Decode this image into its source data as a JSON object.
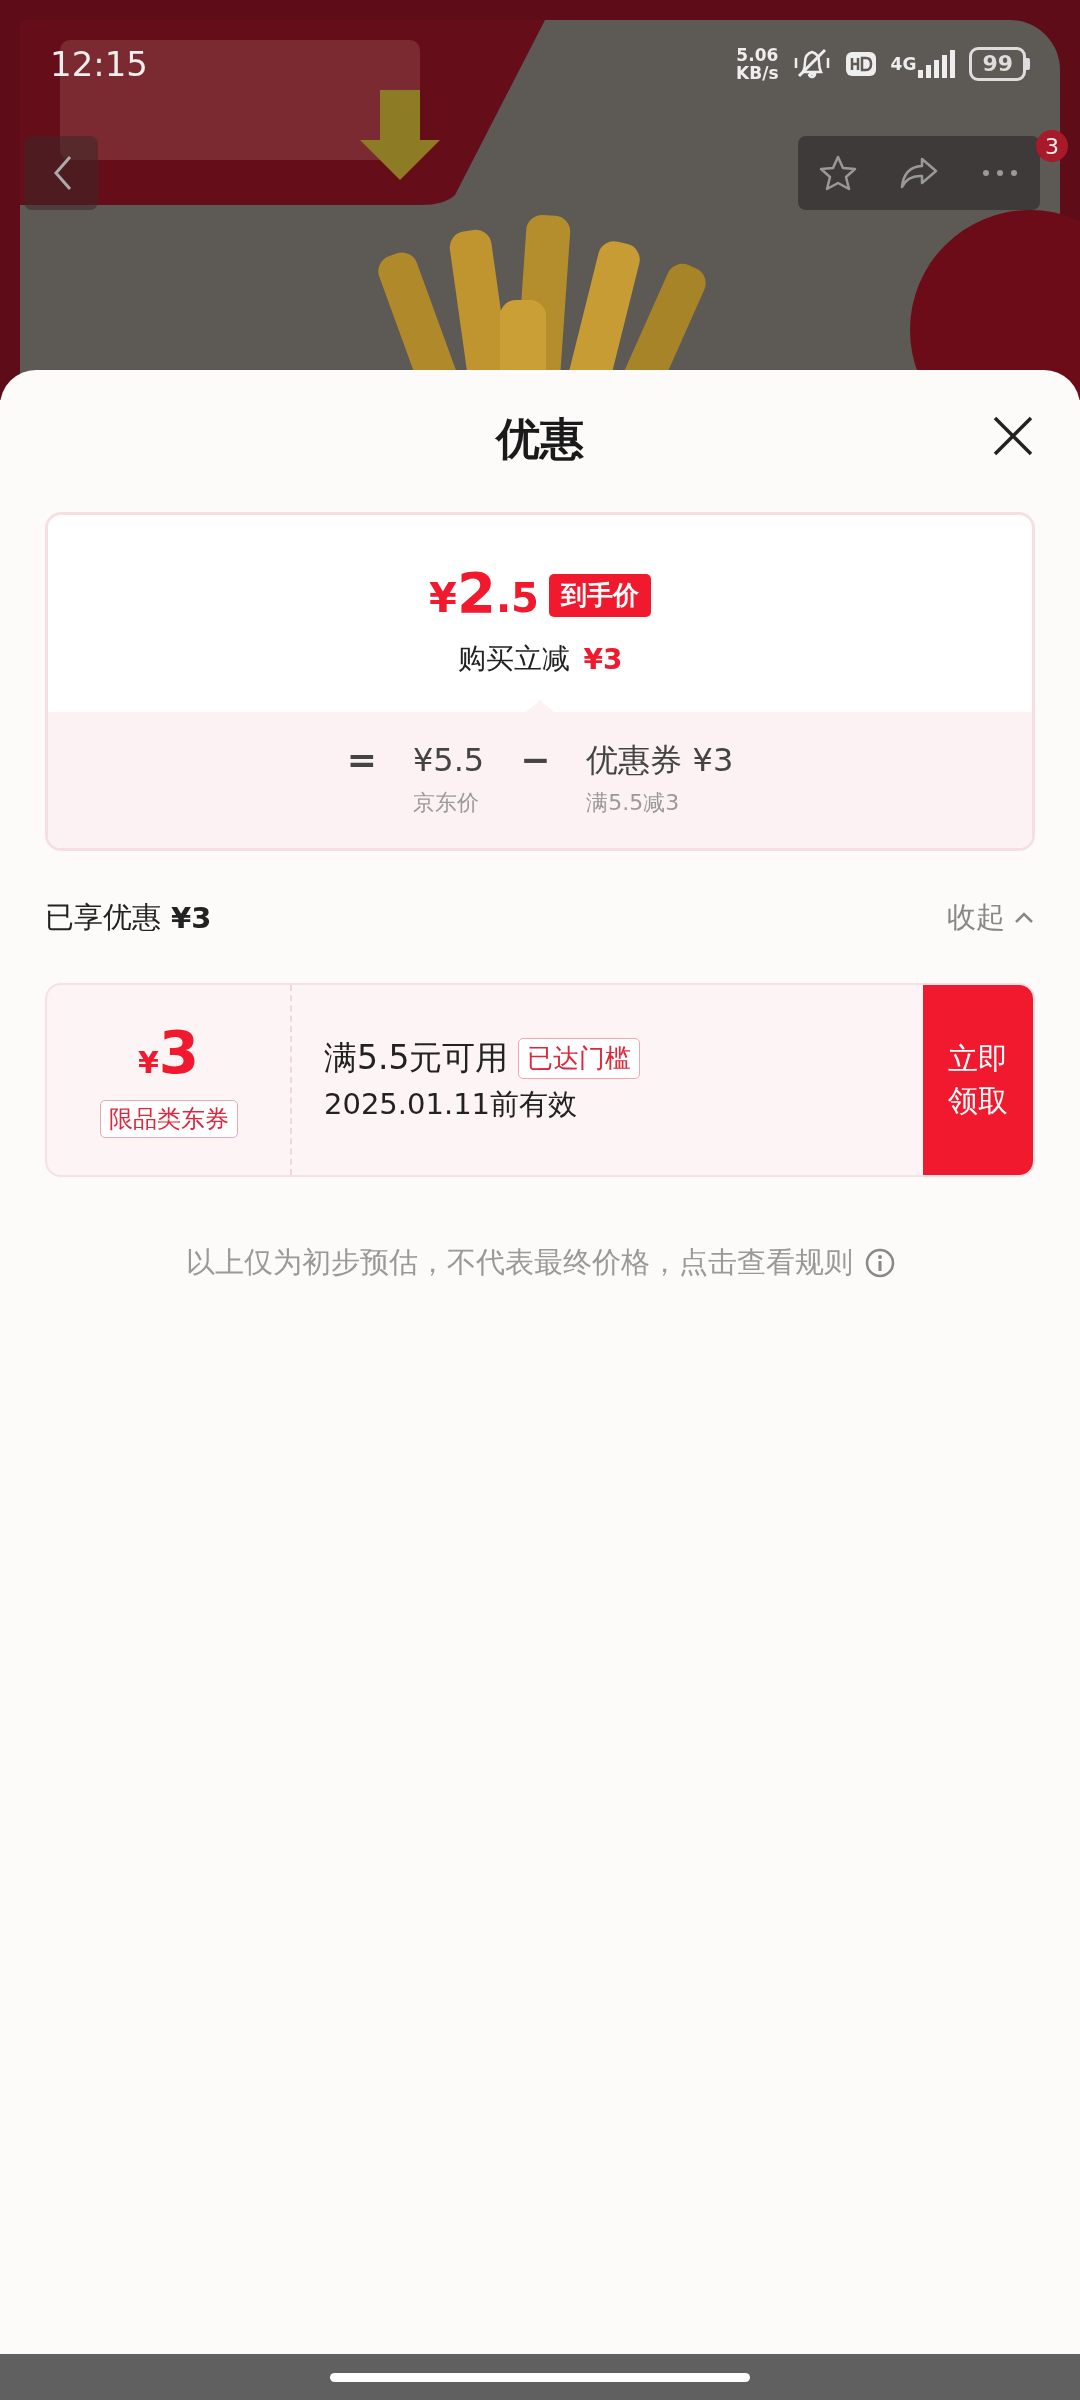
{
  "status_bar": {
    "time": "12:15",
    "net_speed": "5.06",
    "net_unit": "KB/s",
    "network": "4G",
    "battery": "99"
  },
  "header": {
    "badge": "3"
  },
  "sheet": {
    "title": "优惠"
  },
  "price_card": {
    "currency": "¥",
    "amount_int": "2",
    "amount_dec": ".5",
    "tag": "到手价",
    "reduction_label": "购买立减",
    "reduction": "¥3"
  },
  "formula": {
    "equals": "=",
    "base_price": "¥5.5",
    "base_label": "京东价",
    "minus": "−",
    "coupon": "优惠券 ¥3",
    "coupon_label": "满5.5减3"
  },
  "applied": {
    "label": "已享优惠",
    "amount": "¥3",
    "toggle": "收起",
    "expanded": true
  },
  "coupons": [
    {
      "currency": "¥",
      "amount": "3",
      "scope": "限品类东券",
      "condition": "满5.5元可用",
      "status": "已达门槛",
      "validity": "2025.01.11前有效",
      "action": "立即领取"
    }
  ],
  "note": "以上仅为初步预估，不代表最终价格，点击查看规则"
}
